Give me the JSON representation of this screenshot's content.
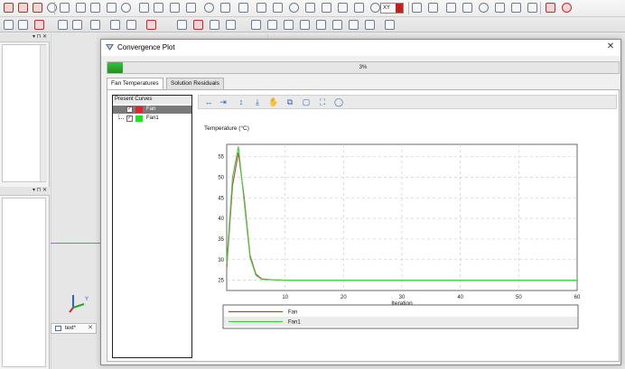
{
  "background_app": {
    "view_selector": "XY",
    "view_tab_label": "text*",
    "view_tab_close": "✕",
    "triad_label": "Y",
    "panel1_controls": "▾ ⊓ ✕",
    "panel2_controls": "▾ ⊓ ✕"
  },
  "dialog": {
    "title": "Convergence Plot",
    "close_glyph": "✕",
    "progress": {
      "percent": 3,
      "label": "3%"
    },
    "tabs": [
      {
        "label": "Fan Temperatures",
        "active": true
      },
      {
        "label": "Solution Residuals",
        "active": false
      }
    ],
    "curves_panel": {
      "header": "Present Curves",
      "items": [
        {
          "label": "Fan",
          "checked": true,
          "color": "#d42a2a",
          "selected": true
        },
        {
          "label": "Fan1",
          "checked": true,
          "color": "#22e022",
          "selected": false
        }
      ]
    },
    "chart_toolbar": [
      {
        "icon": "pan-left-right-icon",
        "glyph": "↔"
      },
      {
        "icon": "zoom-horizontal-icon",
        "glyph": "⇥"
      },
      {
        "icon": "pan-up-down-icon",
        "glyph": "↕"
      },
      {
        "icon": "zoom-vertical-icon",
        "glyph": "⤓"
      },
      {
        "icon": "hand-pan-icon",
        "glyph": "✋"
      },
      {
        "icon": "zoom-box-icon",
        "glyph": "⧉"
      },
      {
        "icon": "fit-window-icon",
        "glyph": "▢"
      },
      {
        "icon": "zoom-extents-icon",
        "glyph": "⛶"
      },
      {
        "icon": "reset-view-icon",
        "glyph": "◯"
      }
    ]
  },
  "chart_data": {
    "type": "line",
    "ylabel": "Temperature (°C)",
    "xlabel": "Iteration",
    "xlim": [
      0,
      60
    ],
    "ylim": [
      22.5,
      58
    ],
    "xticks": [
      10,
      20,
      30,
      40,
      50,
      60
    ],
    "yticks": [
      25,
      30,
      35,
      40,
      45,
      50,
      55
    ],
    "grid": true,
    "legend_position": "bottom",
    "series": [
      {
        "name": "Fan",
        "color": "#c83a3a",
        "x": [
          0,
          1,
          2,
          3,
          4,
          5,
          6,
          8,
          10,
          20,
          30,
          40,
          50,
          60
        ],
        "y": [
          28,
          48,
          56,
          45,
          31,
          26.5,
          25.3,
          25.1,
          25,
          25,
          25,
          25,
          25,
          25
        ]
      },
      {
        "name": "Fan1",
        "color": "#3fd13f",
        "x": [
          0,
          1,
          2,
          3,
          4,
          5,
          6,
          8,
          10,
          20,
          30,
          40,
          50,
          60
        ],
        "y": [
          29,
          50,
          57.5,
          44,
          30.5,
          26.2,
          25.2,
          25.1,
          25,
          25,
          25,
          25,
          25,
          25
        ]
      }
    ]
  }
}
